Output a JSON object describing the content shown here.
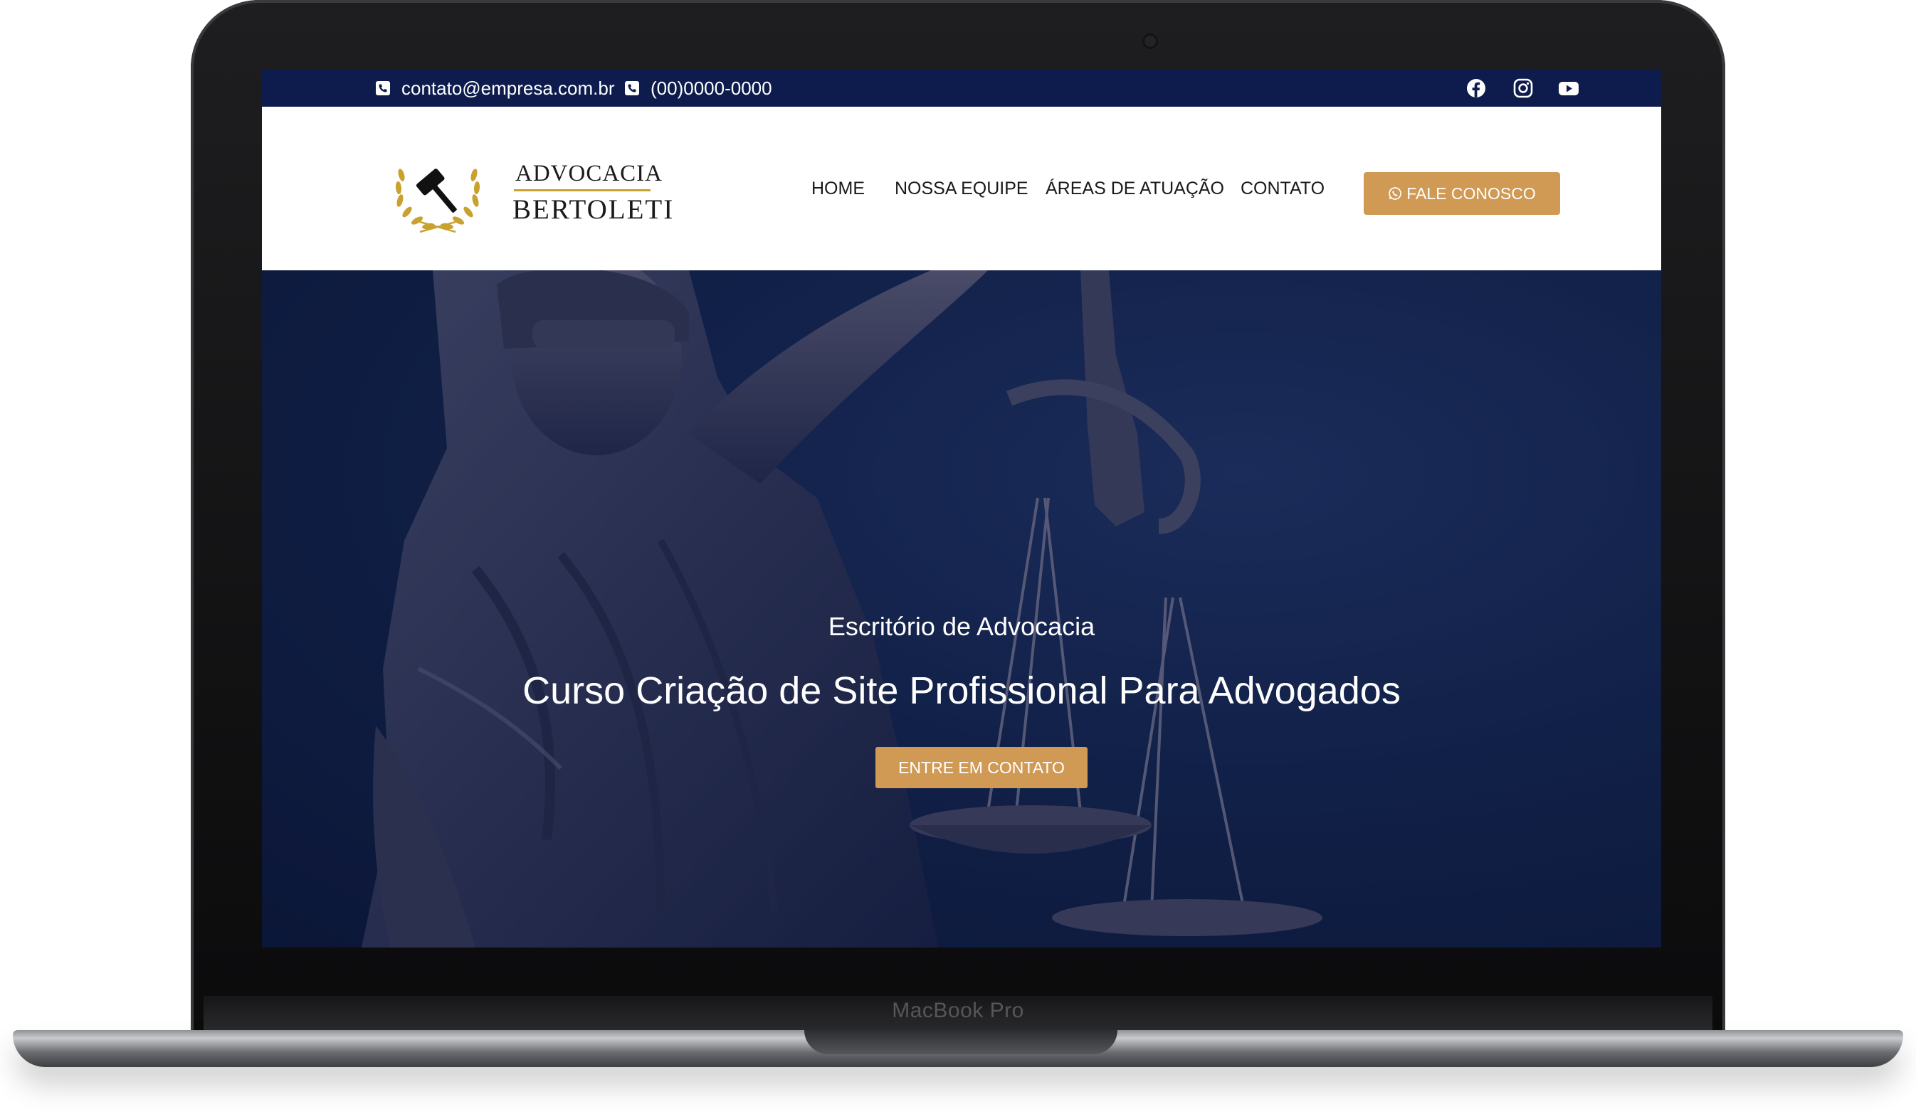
{
  "device": {
    "brand_label": "MacBook Pro"
  },
  "topbar": {
    "email": "contato@empresa.com.br",
    "phone": "(00)0000-0000",
    "email_icon": "phone-square-icon",
    "phone_icon": "phone-square-icon",
    "social_icons": [
      "facebook-icon",
      "instagram-icon",
      "youtube-icon"
    ]
  },
  "logo": {
    "line1": "ADVOCACIA",
    "line2": "BERTOLETI",
    "emblem_icon": "gavel-laurel-icon"
  },
  "nav": {
    "items": [
      {
        "label": "HOME"
      },
      {
        "label": "NOSSA EQUIPE"
      },
      {
        "label": "ÁREAS DE ATUAÇÃO"
      },
      {
        "label": "CONTATO"
      }
    ],
    "cta_label": "FALE CONOSCO",
    "cta_icon": "whatsapp-icon"
  },
  "hero": {
    "subtitle": "Escritório de Advocacia",
    "title": "Curso Criação de Site Profissional Para Advogados",
    "button_label": "ENTRE EM CONTATO"
  },
  "colors": {
    "topbar_bg": "#0d1c4d",
    "accent": "#d09a55",
    "hero_bg": "#15264f",
    "logo_gold": "#c9a12f"
  }
}
